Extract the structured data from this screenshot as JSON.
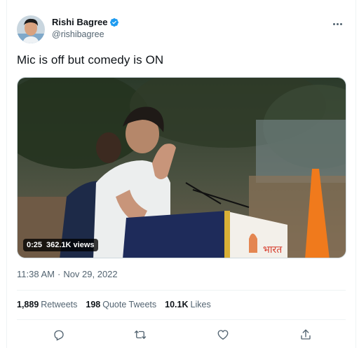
{
  "tweet": {
    "author": {
      "display_name": "Rishi Bagree",
      "handle": "@rishibagree",
      "verified": true
    },
    "text": "Mic is off but comedy is ON",
    "media": {
      "type": "video",
      "duration": "0:25",
      "views": "362.1K views"
    },
    "time": "11:38 AM",
    "separator": "·",
    "date": "Nov 29, 2022",
    "stats": {
      "retweets_count": "1,889",
      "retweets_label": "Retweets",
      "quotes_count": "198",
      "quotes_label": "Quote Tweets",
      "likes_count": "10.1K",
      "likes_label": "Likes"
    }
  },
  "icons": {
    "more": "more-icon",
    "reply": "reply-icon",
    "retweet": "retweet-icon",
    "like": "heart-icon",
    "share": "share-icon",
    "verified": "verified-badge-icon"
  },
  "colors": {
    "text_primary": "#0f1419",
    "text_secondary": "#536471",
    "verified_blue": "#1d9bf0",
    "divider": "#eff3f4"
  }
}
